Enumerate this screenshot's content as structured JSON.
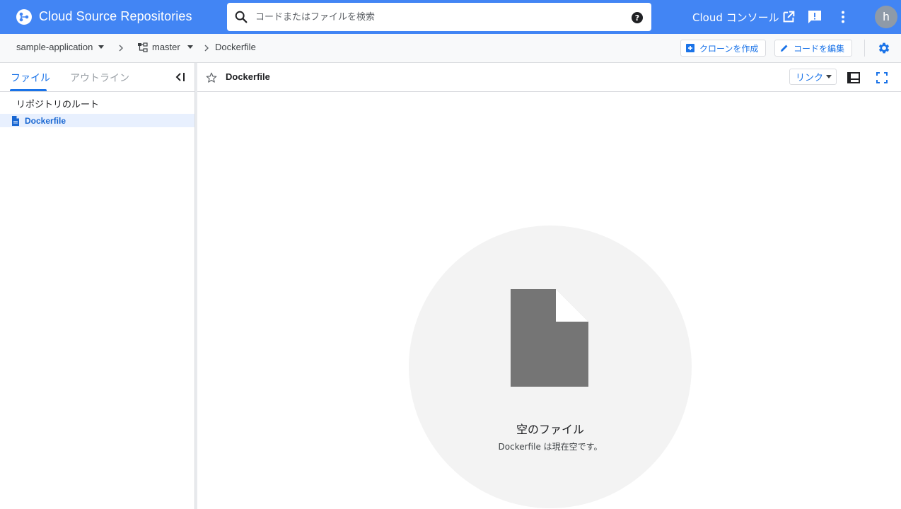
{
  "header": {
    "app_title": "Cloud Source Repositories",
    "search_placeholder": "コードまたはファイルを検索",
    "console_link": "Cloud コンソール",
    "avatar_initial": "h",
    "brand_color": "#4285f4"
  },
  "breadcrumb": {
    "repository": "sample-application",
    "branch": "master",
    "file": "Dockerfile",
    "clone_button": "クローンを作成",
    "edit_button": "コードを編集"
  },
  "sidebar": {
    "tabs": [
      {
        "label": "ファイル",
        "active": true
      },
      {
        "label": "アウトライン",
        "active": false
      }
    ],
    "root_label": "リポジトリのルート",
    "files": [
      {
        "name": "Dockerfile",
        "selected": true
      }
    ]
  },
  "viewer": {
    "filename": "Dockerfile",
    "link_button": "リンク",
    "empty_title": "空のファイル",
    "empty_description": "Dockerfile は現在空です。"
  }
}
